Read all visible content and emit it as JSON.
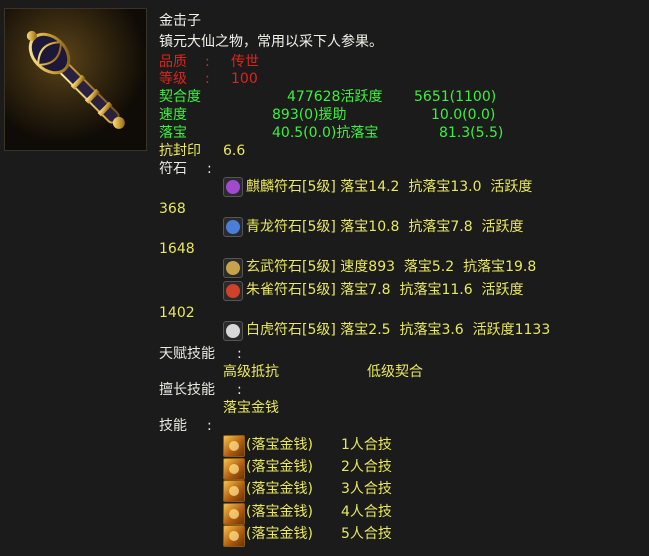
{
  "item": {
    "name": "金击子",
    "desc": "镇元大仙之物，常用以采下人参果。",
    "quality_label": "品质",
    "quality_sep": ":",
    "quality_value": "传世",
    "level_label": "等级",
    "level_sep": ":",
    "level_value": "100"
  },
  "stats": [
    {
      "label": "契合度",
      "mid": "477628活跃度",
      "right": "5651(1100)"
    },
    {
      "label": "速度",
      "mid": "893(0)援助",
      "right": "10.0(0.0)"
    },
    {
      "label": "落宝",
      "mid": "40.5(0.0)抗落宝",
      "right": "81.3(5.5)"
    }
  ],
  "seal": {
    "label": "抗封印",
    "value": "6.6"
  },
  "runes_label": "符石",
  "runes_sep": ":",
  "runes": [
    {
      "text": "麒麟符石[5级] 落宝14.2  抗落宝13.0  活跃度",
      "wrap": "368",
      "color": "#a04ad0"
    },
    {
      "text": "青龙符石[5级] 落宝10.8  抗落宝7.8  活跃度",
      "wrap": "1648",
      "color": "#4a7ed8"
    },
    {
      "text": "玄武符石[5级] 速度893  落宝5.2  抗落宝19.8",
      "wrap": "",
      "color": "#c8a24a"
    },
    {
      "text": "朱雀符石[5级] 落宝7.8  抗落宝11.6  活跃度",
      "wrap": "1402",
      "color": "#d0402a"
    },
    {
      "text": "白虎符石[5级] 落宝2.5  抗落宝3.6  活跃度1133",
      "wrap": "",
      "color": "#d8d8d8"
    }
  ],
  "talent": {
    "label": "天赋技能",
    "sep": ":",
    "items": [
      "高级抵抗",
      "低级契合"
    ]
  },
  "specialty": {
    "label": "擅长技能",
    "sep": ":",
    "value": "落宝金钱"
  },
  "skills": {
    "label": "技能",
    "sep": ":",
    "items": [
      {
        "name": "(落宝金钱)",
        "combo": "1人合技"
      },
      {
        "name": "(落宝金钱)",
        "combo": "2人合技"
      },
      {
        "name": "(落宝金钱)",
        "combo": "3人合技"
      },
      {
        "name": "(落宝金钱)",
        "combo": "4人合技"
      },
      {
        "name": "(落宝金钱)",
        "combo": "5人合技"
      }
    ]
  },
  "colors": {
    "quality": "#d8261e",
    "stats": "#3cf03c",
    "values": "#e9e75b"
  }
}
